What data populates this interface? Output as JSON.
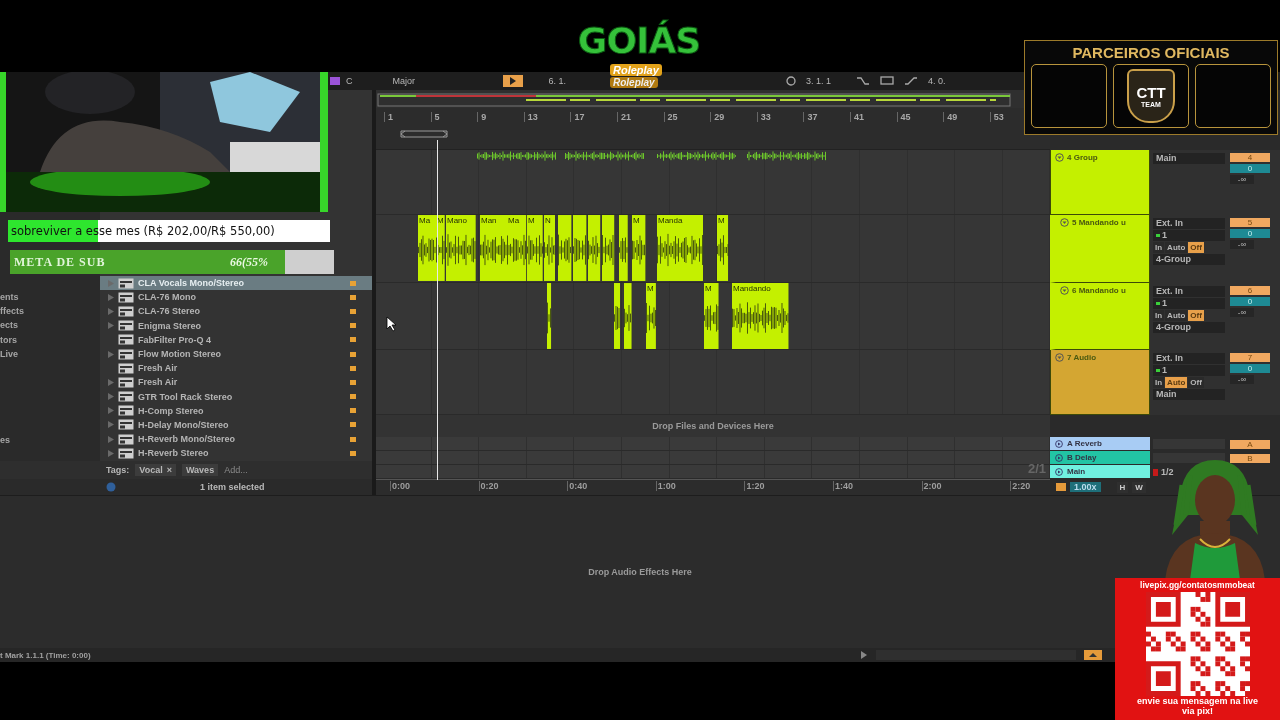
{
  "toolbar": {
    "key": "C",
    "scale": "Major",
    "position": "6. 1.",
    "loop_start": "3. 1. 1",
    "loop_length": "4. 0."
  },
  "browser": {
    "categories": [
      "ents",
      "ffects",
      "ects",
      "tors",
      "Live"
    ],
    "category_tail": "es",
    "items": [
      {
        "name": "CLA Vocals Mono/Stereo",
        "expandable": true,
        "selected": true
      },
      {
        "name": "CLA-76 Mono",
        "expandable": true,
        "selected": false
      },
      {
        "name": "CLA-76 Stereo",
        "expandable": true,
        "selected": false
      },
      {
        "name": "Enigma Stereo",
        "expandable": true,
        "selected": false
      },
      {
        "name": "FabFilter Pro-Q 4",
        "expandable": false,
        "selected": false
      },
      {
        "name": "Flow Motion Stereo",
        "expandable": true,
        "selected": false
      },
      {
        "name": "Fresh Air",
        "expandable": false,
        "selected": false
      },
      {
        "name": "Fresh Air",
        "expandable": true,
        "selected": false
      },
      {
        "name": "GTR Tool Rack Stereo",
        "expandable": true,
        "selected": false
      },
      {
        "name": "H-Comp Stereo",
        "expandable": true,
        "selected": false
      },
      {
        "name": "H-Delay Mono/Stereo",
        "expandable": true,
        "selected": false
      },
      {
        "name": "H-Reverb Mono/Stereo",
        "expandable": true,
        "selected": false
      },
      {
        "name": "H-Reverb Stereo",
        "expandable": true,
        "selected": false
      }
    ],
    "tags": {
      "label": "Tags:",
      "chips": [
        {
          "label": "Vocal",
          "remove": "×"
        },
        {
          "label": "Waves"
        }
      ],
      "add_placeholder": "Add..."
    },
    "status": "1 item selected"
  },
  "arrangement": {
    "ruler": [
      "1",
      "5",
      "9",
      "13",
      "17",
      "21",
      "25",
      "29",
      "33",
      "37",
      "41",
      "45",
      "49",
      "53"
    ],
    "drop_hint": "Drop Files and Devices Here",
    "zoom_ratio": "2/1",
    "time_ruler": [
      "0:00",
      "0:20",
      "0:40",
      "1:00",
      "1:20",
      "1:40",
      "2:00",
      "2:20"
    ]
  },
  "tracks": [
    {
      "name": "4 Group",
      "kind": "group",
      "color": "#c4f000",
      "in_group": false,
      "output": "Main",
      "number": "4",
      "volume": "0",
      "meter": "-∞"
    },
    {
      "name": "5 Mandando u",
      "kind": "audio",
      "color": "#c4f000",
      "in_group": true,
      "input": "Ext. In",
      "channel": "1",
      "monitor": [
        {
          "label": "In",
          "selected": false
        },
        {
          "label": "Auto",
          "selected": false
        },
        {
          "label": "Off",
          "selected": true
        }
      ],
      "output": "4-Group",
      "number": "5",
      "volume": "0",
      "meter": "-∞",
      "clip_labels": [
        "Ma",
        "M",
        "Mano",
        "Man",
        "Ma",
        "M",
        "N",
        "M",
        "Manda",
        "M"
      ]
    },
    {
      "name": "6 Mandando u",
      "kind": "audio",
      "color": "#c4f000",
      "in_group": true,
      "input": "Ext. In",
      "channel": "1",
      "monitor": [
        {
          "label": "In",
          "selected": false
        },
        {
          "label": "Auto",
          "selected": false
        },
        {
          "label": "Off",
          "selected": true
        }
      ],
      "output": "4-Group",
      "number": "6",
      "volume": "0",
      "meter": "-∞",
      "clip_labels": [
        "M",
        "M",
        "Mandando"
      ]
    },
    {
      "name": "7 Audio",
      "kind": "audio",
      "color": "#d4a632",
      "in_group": false,
      "input": "Ext. In",
      "channel": "1",
      "monitor": [
        {
          "label": "In",
          "selected": false
        },
        {
          "label": "Auto",
          "selected": true
        },
        {
          "label": "Off",
          "selected": false
        }
      ],
      "output": "Main",
      "number": "7",
      "volume": "0",
      "meter": "-∞"
    }
  ],
  "returns": [
    {
      "name": "A Reverb",
      "kind": "return",
      "color": "#a8ccf4",
      "number": "A"
    },
    {
      "name": "B Delay",
      "kind": "return",
      "color": "#22c4a4",
      "number": "B"
    },
    {
      "name": "Main",
      "kind": "main",
      "color": "#70f0e0",
      "meter": "1/2"
    }
  ],
  "footer": {
    "speed": "1.00x",
    "buttons": [
      "H",
      "W"
    ]
  },
  "device_view": {
    "hint": "Drop Audio Effects Here"
  },
  "status_bar": "t Mark 1.1.1 (Time: 0:00)",
  "overlays": {
    "goal": {
      "text": "sobreviver a esse mes (R$ 202,00/R$ 550,00)",
      "level": 0.28
    },
    "sub_goal": {
      "label": "META DE SUB",
      "value": "66(55%",
      "level": 0.85
    },
    "logo": {
      "title": "GOIÁS",
      "subtitles": [
        "Roleplay",
        "Roleplay"
      ]
    },
    "partners": {
      "title": "PARCEIROS OFICIAIS",
      "slots": [
        {
          "kind": "empty"
        },
        {
          "kind": "logo",
          "badge": "CTT",
          "caption": "TEAM"
        },
        {
          "kind": "empty"
        }
      ]
    },
    "pix": {
      "url": "livepix.gg/contatosmmobeat",
      "message": "envie sua mensagem na live via pix!"
    }
  }
}
